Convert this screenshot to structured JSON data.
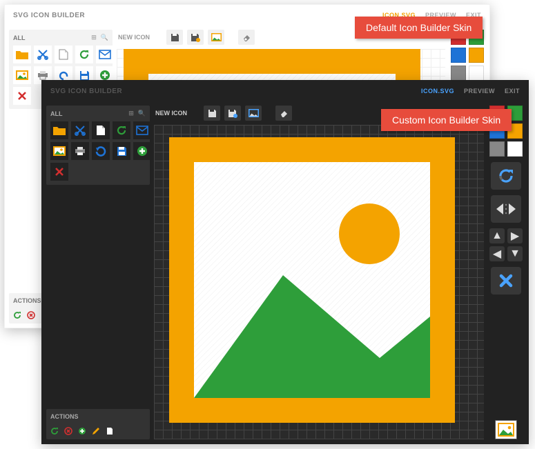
{
  "app_title": "SVG ICON BUILDER",
  "top_links": {
    "active": "ICON.SVG",
    "preview": "PREVIEW",
    "exit": "EXIT"
  },
  "panel_all": "ALL",
  "panel_actions": "ACTIONS",
  "new_icon": "NEW ICON",
  "badge_default": "Default Icon Builder Skin",
  "badge_custom": "Custom Icon Builder Skin",
  "colors": {
    "red": "#d32f2f",
    "green": "#2e9e3a",
    "blue": "#1e73d6",
    "orange": "#f4a300",
    "gray": "#888888",
    "white": "#ffffff"
  },
  "icons": {
    "folder": "folder",
    "scissors": "scissors",
    "document": "document",
    "refresh": "refresh",
    "mail": "mail",
    "picture": "picture",
    "printer": "printer",
    "undo": "undo",
    "save": "save",
    "add": "add",
    "close": "close"
  }
}
